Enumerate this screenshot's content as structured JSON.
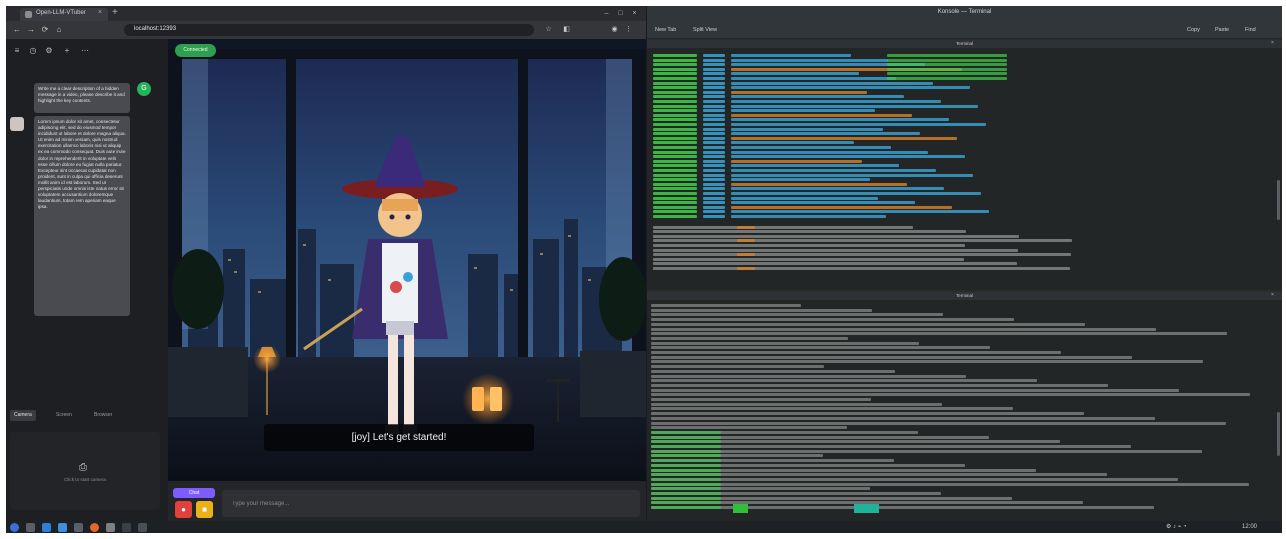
{
  "browser": {
    "tab_title": "Open-LLM-VTuber",
    "tab_close": "×",
    "new_tab": "+",
    "nav": {
      "back": "←",
      "forward": "→",
      "reload": "⟳",
      "home": "⌂"
    },
    "url_prefix": "",
    "url_host": "localhost:12393",
    "url_suffix": "",
    "window_controls": {
      "minimize": "–",
      "maximize": "□",
      "close": "×"
    }
  },
  "chat": {
    "top_icons": {
      "menu": "≡",
      "history": "◷",
      "settings": "⚙",
      "plus": "+",
      "more": "⋯"
    },
    "user_avatar": "G",
    "user_message": "Write me a clear description of a hidden message in a video, please describe it and highlight the key contents.",
    "bot_message": "Lorem ipsum dolor sit amet, consectetur adipiscing elit, sed do eiusmod tempor incididunt ut labore et dolore magna aliqua. Ut enim ad minim veniam, quis nostrud exercitation ullamco laboris nisi ut aliquip ex ea commodo consequat. Duis aute irure dolor in reprehenderit in voluptate velit esse cillum dolore eu fugiat nulla pariatur. Excepteur sint occaecat cupidatat non proident, sunt in culpa qui officia deserunt mollit anim id est laborum. Sed ut perspiciatis unde omnis iste natus error sit voluptatem accusantium doloremque laudantium, totam rem aperiam eaque ipsa.",
    "tabs": [
      "Camera",
      "Screen",
      "Browser"
    ],
    "drop_icon": "⎙",
    "drop_text": "Click to start camera"
  },
  "stage": {
    "status": "Connected",
    "subtitle": "[joy] Let's get started!"
  },
  "controls": {
    "mode_label": "Chat",
    "mic_icon": "●",
    "cam_icon": "■",
    "input_placeholder": "Type your message..."
  },
  "terminal": {
    "title": "Konsole — Terminal",
    "toolbar": [
      "New Tab",
      "Split View",
      "Copy",
      "Paste",
      "Find"
    ],
    "pane_top_title": "Terminal",
    "pane_bottom_title": "Terminal",
    "pane_close": "×"
  },
  "taskbar": {
    "tray_time": "12:00"
  },
  "colors": {
    "status_green": "#2f9e4f",
    "mode_purple": "#7c5cff",
    "mic_red": "#e0413c",
    "cam_yellow": "#e9b21a",
    "term_green": "#3fcf4a",
    "term_blue": "#3aa6d8",
    "term_orange": "#d9822b",
    "term_grey": "#b8b8b8"
  }
}
